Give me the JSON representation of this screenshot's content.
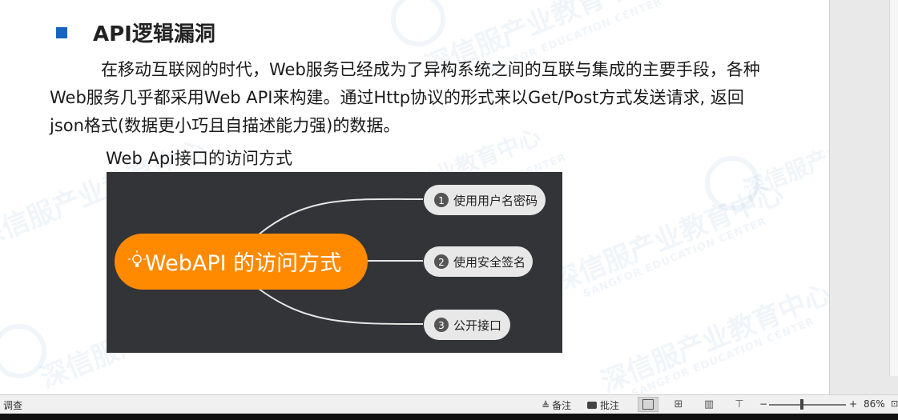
{
  "document": {
    "heading": "API逻辑漏洞",
    "paragraph": "在移动互联网的时代，Web服务已经成为了异构系统之间的互联与集成的主要手段，各种Web服务几乎都采用Web API来构建。通过Http协议的形式来以Get/Post方式发送请求, 返回json格式(数据更小巧且自描述能力强)的数据。",
    "caption": "Web Api接口的访问方式"
  },
  "mindmap": {
    "root": "WebAPI 的访问方式",
    "branches": [
      {
        "num": "1",
        "label": "使用用户名密码"
      },
      {
        "num": "2",
        "label": "使用安全签名"
      },
      {
        "num": "3",
        "label": "公开接口"
      }
    ],
    "colors": {
      "background": "#323437",
      "root": "#ff8a00",
      "node": "#e8e8e8",
      "line": "#e6e6e6"
    }
  },
  "watermark": {
    "text": "深信服产业教育中心",
    "subtext": "SANGFOR EDUCATION CENTER"
  },
  "statusbar": {
    "left_text": "调查",
    "notes_label": "备注",
    "comments_label": "批注",
    "zoom_minus": "−",
    "zoom_plus": "+",
    "zoom": "86%"
  }
}
